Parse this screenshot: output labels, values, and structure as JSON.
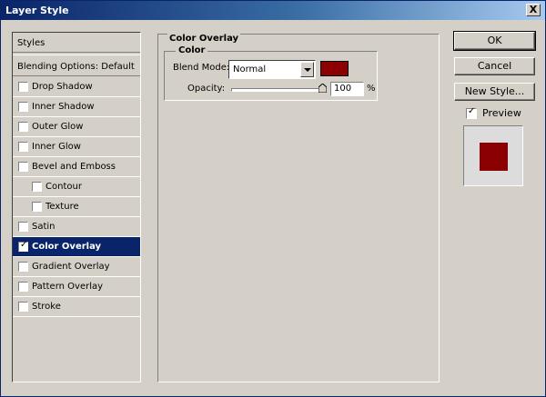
{
  "window": {
    "title": "Layer Style",
    "close_label": "X"
  },
  "styles_panel": {
    "header": "Styles",
    "blending_options": "Blending Options: Default",
    "items": [
      {
        "label": "Drop Shadow",
        "checked": false,
        "indent": false,
        "selected": false
      },
      {
        "label": "Inner Shadow",
        "checked": false,
        "indent": false,
        "selected": false
      },
      {
        "label": "Outer Glow",
        "checked": false,
        "indent": false,
        "selected": false
      },
      {
        "label": "Inner Glow",
        "checked": false,
        "indent": false,
        "selected": false
      },
      {
        "label": "Bevel and Emboss",
        "checked": false,
        "indent": false,
        "selected": false
      },
      {
        "label": "Contour",
        "checked": false,
        "indent": true,
        "selected": false
      },
      {
        "label": "Texture",
        "checked": false,
        "indent": true,
        "selected": false
      },
      {
        "label": "Satin",
        "checked": false,
        "indent": false,
        "selected": false
      },
      {
        "label": "Color Overlay",
        "checked": true,
        "indent": false,
        "selected": true
      },
      {
        "label": "Gradient Overlay",
        "checked": false,
        "indent": false,
        "selected": false
      },
      {
        "label": "Pattern Overlay",
        "checked": false,
        "indent": false,
        "selected": false
      },
      {
        "label": "Stroke",
        "checked": false,
        "indent": false,
        "selected": false
      }
    ]
  },
  "color_overlay": {
    "group_title": "Color Overlay",
    "sub_title": "Color",
    "blend_mode_label": "Blend Mode:",
    "blend_mode_value": "Normal",
    "overlay_color": "#8b0000",
    "opacity_label": "Opacity:",
    "opacity_value": "100",
    "opacity_unit": "%"
  },
  "buttons": {
    "ok": "OK",
    "cancel": "Cancel",
    "new_style": "New Style..."
  },
  "preview": {
    "label": "Preview",
    "checked": true,
    "fill_color": "#8b0000"
  },
  "colors": {
    "accent": "#0a246a",
    "dialog_bg": "#d4d0c8"
  }
}
